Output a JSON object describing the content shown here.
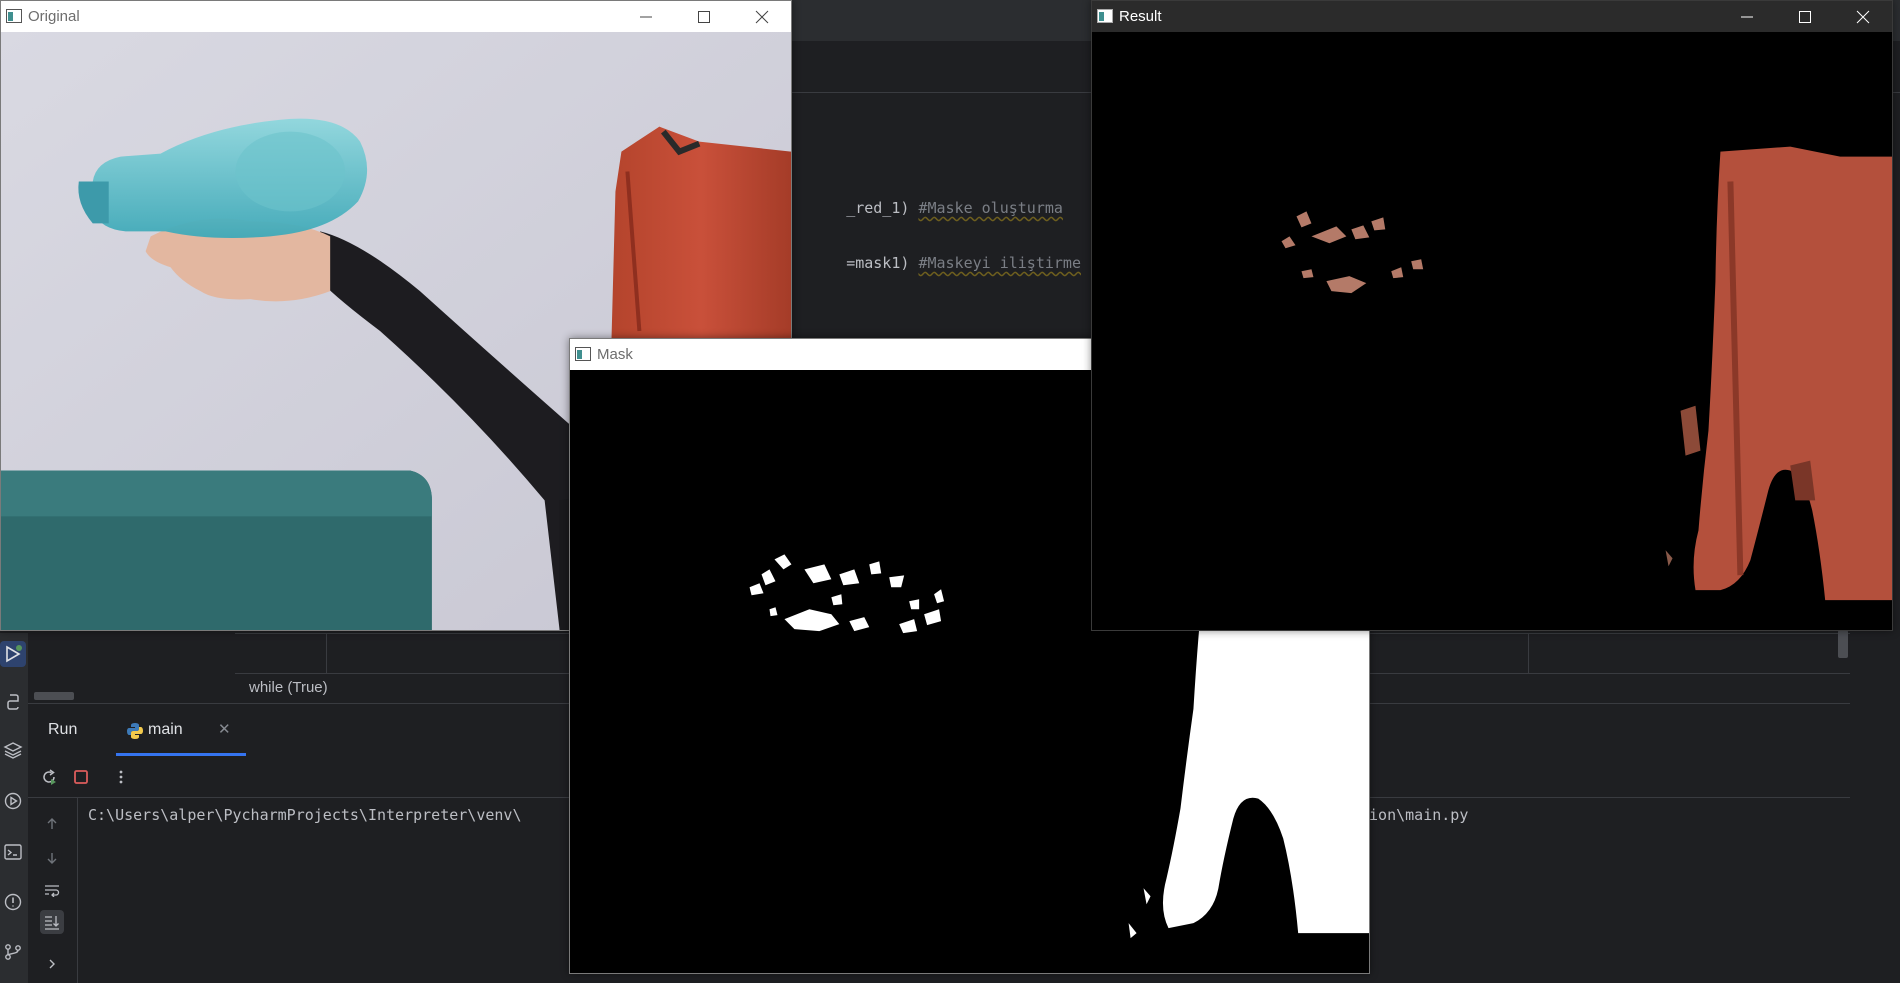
{
  "windows": {
    "original": {
      "title": "Original"
    },
    "mask": {
      "title": "Mask"
    },
    "result": {
      "title": "Result"
    }
  },
  "editor": {
    "line1_code": "_red_1) ",
    "line1_comment": "#Maske oluşturma",
    "line2_code": "=mask1) ",
    "line2_comment": "#Maskeyi iliştirme"
  },
  "breadcrumb": {
    "text": "while (True)"
  },
  "run_panel": {
    "label": "Run",
    "tab_label": "main",
    "console_path_start": "C:\\Users\\alper\\PycharmProjects\\Interpreter\\venv\\",
    "console_path_end": "tion\\main.py"
  },
  "icons": {
    "toolstrip": [
      "run-icon",
      "python-console-icon",
      "layers-icon",
      "services-icon",
      "terminal-icon",
      "problems-icon",
      "git-icon"
    ],
    "run_toolbar": [
      "rerun-icon",
      "stop-icon",
      "more-icon"
    ],
    "console_side": [
      "scroll-up-icon",
      "scroll-down-icon",
      "soft-wrap-icon",
      "scroll-to-end-icon",
      "expand-icon"
    ]
  },
  "colors": {
    "ide_bg": "#1e1f22",
    "accent": "#3574f0",
    "stop": "#db5c5c",
    "rerun": "#57965c"
  }
}
